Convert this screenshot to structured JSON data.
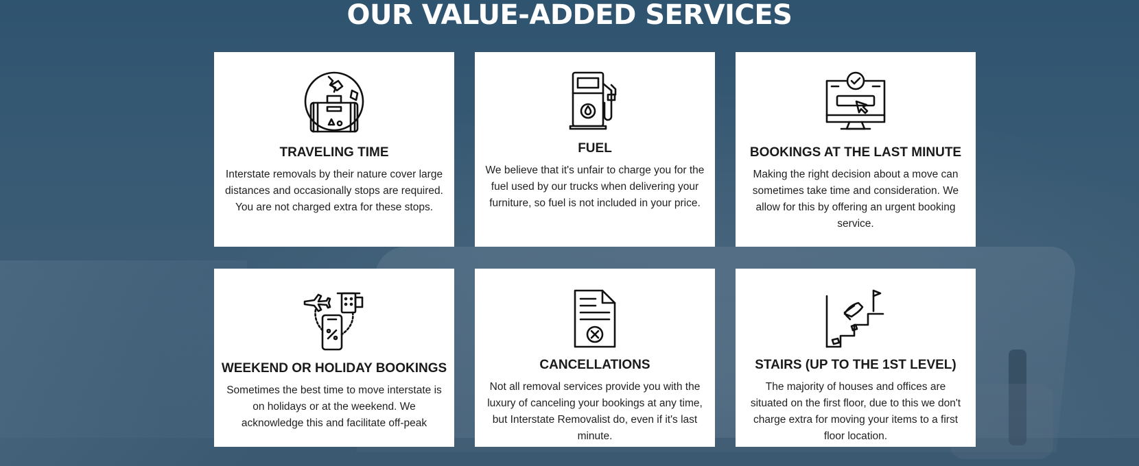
{
  "section": {
    "title": "OUR VALUE-ADDED SERVICES"
  },
  "services": [
    {
      "title": "TRAVELING TIME",
      "description": "Interstate removals by their nature cover large distances and occasionally stops are required. You are not charged extra for these stops.",
      "icon": "globe-suitcase-icon"
    },
    {
      "title": "FUEL",
      "description": "We believe that it's unfair to charge you for the fuel used by our trucks when delivering your furniture, so fuel is not included in your price.",
      "icon": "fuel-pump-icon"
    },
    {
      "title": "BOOKINGS AT THE LAST MINUTE",
      "description": "Making the right decision about a move can sometimes take time and consideration. We allow for this by offering an urgent booking service.",
      "icon": "monitor-booking-icon"
    },
    {
      "title": "WEEKEND OR HOLIDAY BOOKINGS",
      "description": "Sometimes the best time to move interstate is on holidays or at the weekend. We acknowledge this and facilitate off-peak",
      "icon": "phone-travel-icon"
    },
    {
      "title": "CANCELLATIONS",
      "description": "Not all removal services provide you with the luxury of canceling your bookings at any time, but Interstate Removalist do, even if it's last minute.",
      "icon": "cancel-document-icon"
    },
    {
      "title": "STAIRS (UP TO THE 1ST LEVEL)",
      "description": "The majority of houses and offices are situated on the first floor, due to this we don't charge extra for moving your items to a first floor location.",
      "icon": "stairs-icon"
    }
  ]
}
